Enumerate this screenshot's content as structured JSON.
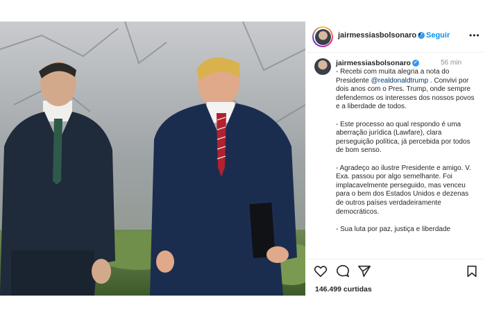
{
  "post": {
    "photo_icon": "post-photo",
    "author": "jairmessiasbolsonaro",
    "follow_label": "Seguir",
    "time": "56 min",
    "mention": "@realdonaldtrump",
    "caption": [
      {
        "pre": "- Recebi com muita alegria a nota do Presidente ",
        "post": " . Convivi por dois anos com o Pres. Trump, onde sempre defendemos os interesses dos nossos povos e a liberdade de todos."
      },
      {
        "text": "- Este processo ao qual respondo é uma aberração jurídica (Lawfare), clara perseguição política, já percebida por todos de bom senso."
      },
      {
        "text": "- Agradeço ao ilustre Presidente e amigo. V. Exa. passou por algo semelhante. Foi implacavelmente perseguido, mas venceu para o bem dos Estados Unidos e dezenas de outros países verdadeiramente democráticos."
      },
      {
        "text": "- Sua luta por paz, justiça e liberdade"
      }
    ],
    "likes": "146.499 curtidas"
  },
  "icons": {
    "verified": "verified-badge-icon",
    "more": "more-options-icon",
    "like": "heart-icon",
    "comment": "comment-icon",
    "share": "share-icon",
    "save": "bookmark-icon"
  },
  "colors": {
    "follow": "#0095f6",
    "verified": "#3897f0",
    "mention": "#00376b"
  }
}
